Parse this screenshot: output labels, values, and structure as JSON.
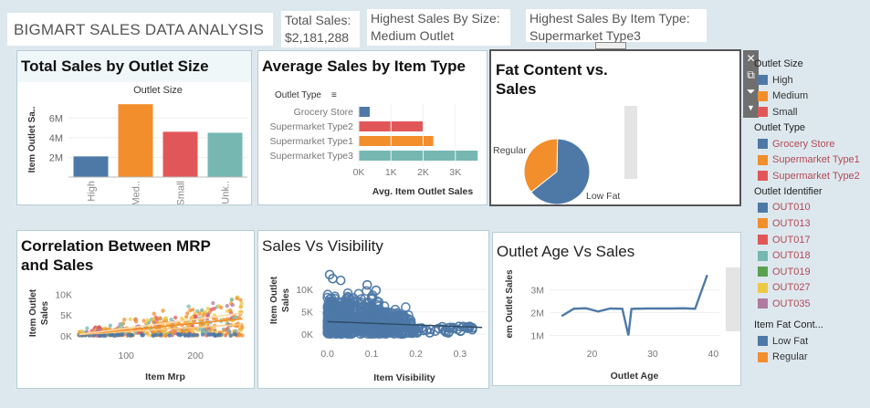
{
  "header": {
    "title": "BIGMART SALES DATA ANALYSIS",
    "kpis": [
      {
        "label": "Total Sales:",
        "value": "$2,181,288"
      },
      {
        "label": "Highest Sales By Size:",
        "value": "Medium Outlet"
      },
      {
        "label": "Highest Sales By Item Type:",
        "value": "Supermarket Type3"
      }
    ]
  },
  "colors": {
    "blue": "#4e79a7",
    "orange": "#f28e2b",
    "red": "#e15759",
    "teal": "#76b7b2",
    "green": "#59a14f",
    "yellow": "#edc948",
    "purple": "#b07aa1",
    "gray": "#bab0ac"
  },
  "toolbar_icons": [
    "close-icon",
    "popout-icon",
    "filter-icon",
    "more-icon"
  ],
  "panels": {
    "outlet_size": {
      "title": "Total Sales by Outlet Size"
    },
    "item_type": {
      "title": "Average Sales by Item Type"
    },
    "fat": {
      "title_l1": "Fat Content vs.",
      "title_l2": "Sales"
    },
    "mrp": {
      "title_l1": "Correlation Between MRP",
      "title_l2": "and Sales"
    },
    "visibility": {
      "title": "Sales Vs Visibility"
    },
    "age": {
      "title": "Outlet Age Vs Sales"
    }
  },
  "legend": {
    "groups": [
      {
        "title": "Outlet Size",
        "items": [
          {
            "label": "High",
            "color": "#4e79a7"
          },
          {
            "label": "Medium",
            "color": "#f28e2b"
          },
          {
            "label": "Small",
            "color": "#e15759"
          }
        ]
      },
      {
        "title": "Outlet Type",
        "items": [
          {
            "label": "Grocery Store",
            "color": "#4e79a7"
          },
          {
            "label": "Supermarket Type1",
            "color": "#f28e2b"
          },
          {
            "label": "Supermarket Type2",
            "color": "#e15759"
          }
        ]
      },
      {
        "title": "Outlet Identifier",
        "items": [
          {
            "label": "OUT010",
            "color": "#4e79a7"
          },
          {
            "label": "OUT013",
            "color": "#f28e2b"
          },
          {
            "label": "OUT017",
            "color": "#e15759"
          },
          {
            "label": "OUT018",
            "color": "#76b7b2"
          },
          {
            "label": "OUT019",
            "color": "#59a14f"
          },
          {
            "label": "OUT027",
            "color": "#edc948"
          },
          {
            "label": "OUT035",
            "color": "#b07aa1"
          }
        ]
      },
      {
        "title": "Item Fat Cont...",
        "items": [
          {
            "label": "Low Fat",
            "color": "#4e79a7"
          },
          {
            "label": "Regular",
            "color": "#f28e2b"
          }
        ]
      }
    ]
  },
  "chart_data": [
    {
      "id": "outlet_size",
      "type": "bar",
      "title": "Total Sales by Outlet Size",
      "subtitle": "Outlet Size",
      "ylabel": "Item Outlet Sa..",
      "categories": [
        "High",
        "Med..",
        "Small",
        "Unk.."
      ],
      "values": [
        2100000,
        7400000,
        4600000,
        4500000
      ],
      "colors": [
        "#4e79a7",
        "#f28e2b",
        "#e15759",
        "#76b7b2"
      ],
      "yticks": [
        {
          "v": 2000000,
          "l": "2M"
        },
        {
          "v": 4000000,
          "l": "4M"
        },
        {
          "v": 6000000,
          "l": "6M"
        }
      ],
      "ylim": [
        0,
        7600000
      ]
    },
    {
      "id": "item_type",
      "type": "bar",
      "orientation": "horizontal",
      "title": "Average Sales by Item Type",
      "legend_title": "Outlet Type",
      "xlabel": "Avg. Item Outlet Sales",
      "categories": [
        "Grocery Store",
        "Supermarket Type2",
        "Supermarket Type1",
        "Supermarket Type3"
      ],
      "values": [
        340,
        1995,
        2316,
        3694
      ],
      "colors": [
        "#4e79a7",
        "#e15759",
        "#f28e2b",
        "#76b7b2"
      ],
      "xticks": [
        {
          "v": 0,
          "l": "0K"
        },
        {
          "v": 1000,
          "l": "1K"
        },
        {
          "v": 2000,
          "l": "2K"
        },
        {
          "v": 3000,
          "l": "3K"
        }
      ],
      "xlim": [
        0,
        3800
      ]
    },
    {
      "id": "fat",
      "type": "pie",
      "title": "Fat Content vs. Sales",
      "slices": [
        {
          "label": "Low Fat",
          "value": 64,
          "color": "#4e79a7"
        },
        {
          "label": "Regular",
          "value": 36,
          "color": "#f28e2b"
        }
      ]
    },
    {
      "id": "mrp",
      "type": "scatter",
      "title": "Correlation Between MRP and Sales",
      "xlabel": "Item Mrp",
      "ylabel": "Item Outlet Sales",
      "xticks": [
        {
          "v": 100,
          "l": "100"
        },
        {
          "v": 200,
          "l": "200"
        }
      ],
      "yticks": [
        {
          "v": 0,
          "l": "0K"
        },
        {
          "v": 5000,
          "l": "5K"
        },
        {
          "v": 10000,
          "l": "10K"
        }
      ],
      "xlim": [
        30,
        275
      ],
      "ylim": [
        -700,
        13000
      ]
    },
    {
      "id": "visibility",
      "type": "scatter",
      "title": "Sales Vs Visibility",
      "xlabel": "Item Visibility",
      "ylabel": "Item Outlet Sales",
      "xticks": [
        {
          "v": 0,
          "l": "0.0"
        },
        {
          "v": 0.1,
          "l": "0.1"
        },
        {
          "v": 0.2,
          "l": "0.2"
        },
        {
          "v": 0.3,
          "l": "0.3"
        }
      ],
      "yticks": [
        {
          "v": 0,
          "l": "0K"
        },
        {
          "v": 5000,
          "l": "5K"
        },
        {
          "v": 10000,
          "l": "10K"
        }
      ],
      "xlim": [
        -0.02,
        0.36
      ],
      "ylim": [
        -1000,
        14500
      ],
      "trend": [
        [
          0,
          2800
        ],
        [
          0.35,
          1500
        ]
      ]
    },
    {
      "id": "age",
      "type": "line",
      "title": "Outlet Age Vs Sales",
      "xlabel": "Outlet Age",
      "ylabel": "em Outlet Sales",
      "x": [
        15,
        17,
        19,
        21,
        23,
        25,
        26,
        26.5,
        27,
        29,
        31,
        33,
        35,
        37,
        39
      ],
      "values": [
        1850000,
        2170000,
        2190000,
        2050000,
        2180000,
        2170000,
        1000000,
        2160000,
        2170000,
        2180000,
        2180000,
        2180000,
        2190000,
        2170000,
        3650000
      ],
      "xticks": [
        {
          "v": 20,
          "l": "20"
        },
        {
          "v": 30,
          "l": "30"
        },
        {
          "v": 40,
          "l": "40"
        }
      ],
      "yticks": [
        {
          "v": 1000000,
          "l": "1M"
        },
        {
          "v": 2000000,
          "l": "2M"
        },
        {
          "v": 3000000,
          "l": "3M"
        }
      ],
      "xlim": [
        13,
        41
      ],
      "ylim": [
        700000,
        3900000
      ]
    }
  ]
}
